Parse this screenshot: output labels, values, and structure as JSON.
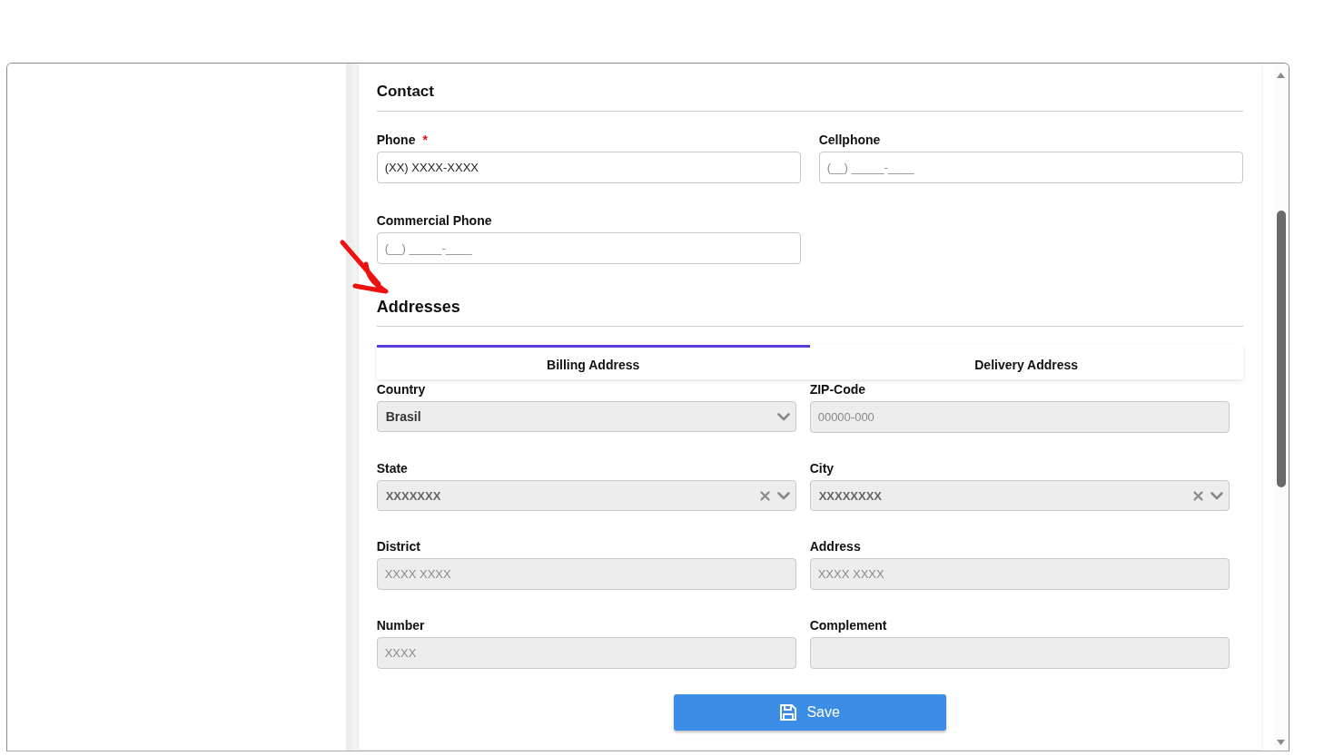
{
  "contact": {
    "title": "Contact",
    "fields": [
      {
        "label": "Phone",
        "required_mark": "*",
        "value": "(XX) XXXX-XXXX"
      },
      {
        "label": "Cellphone",
        "placeholder": "(__) _____-____"
      },
      {
        "label": "Commercial Phone",
        "placeholder": "(__) _____-____"
      }
    ]
  },
  "addresses": {
    "title": "Addresses",
    "tabs": [
      {
        "label": "Billing Address",
        "selected": true
      },
      {
        "label": "Delivery Address",
        "selected": false
      }
    ],
    "fields": [
      {
        "kind": "select",
        "label": "Country",
        "value": "Brasil",
        "clearable": false
      },
      {
        "kind": "input",
        "label": "ZIP-Code",
        "placeholder": "00000-000"
      },
      {
        "kind": "select",
        "label": "State",
        "value": "XXXXXXX",
        "clearable": true
      },
      {
        "kind": "select",
        "label": "City",
        "value": "XXXXXXXX",
        "clearable": true
      },
      {
        "kind": "input",
        "label": "District",
        "placeholder": "XXXX XXXX"
      },
      {
        "kind": "input",
        "label": "Address",
        "placeholder": "XXXX XXXX"
      },
      {
        "kind": "input",
        "label": "Number",
        "placeholder": "XXXX"
      },
      {
        "kind": "input",
        "label": "Complement"
      }
    ]
  },
  "save_button": {
    "label": "Save"
  }
}
